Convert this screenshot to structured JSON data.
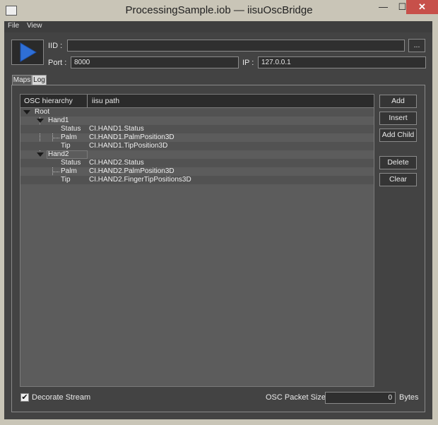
{
  "window": {
    "title": "ProcessingSample.iob — iisuOscBridge",
    "minimize_glyph": "—",
    "maximize_glyph": "☐",
    "close_glyph": "✕"
  },
  "menu": {
    "file": "File",
    "view": "View"
  },
  "header": {
    "iid_label": "IID :",
    "iid_value": "",
    "browse_label": "...",
    "port_label": "Port :",
    "port_value": "8000",
    "ip_label": "IP :",
    "ip_value": "127.0.0.1"
  },
  "tabs": {
    "maps": "Maps",
    "log": "Log"
  },
  "tree": {
    "col_osc": "OSC hierarchy",
    "col_path": "iisu path",
    "rows": [
      {
        "label": "Root",
        "path": ""
      },
      {
        "label": "Hand1",
        "path": ""
      },
      {
        "label": "Status",
        "path": "CI.HAND1.Status"
      },
      {
        "label": "Palm",
        "path": "CI.HAND1.PalmPosition3D"
      },
      {
        "label": "Tip",
        "path": "CI.HAND1.TipPosition3D"
      },
      {
        "label": "Hand2",
        "path": ""
      },
      {
        "label": "Status",
        "path": "CI.HAND2.Status"
      },
      {
        "label": "Palm",
        "path": "CI.HAND2.PalmPosition3D"
      },
      {
        "label": "Tip",
        "path": "CI.HAND2.FingerTipPositions3D"
      }
    ]
  },
  "buttons": {
    "add": "Add",
    "insert": "Insert",
    "add_child": "Add Child",
    "delete": "Delete",
    "clear": "Clear"
  },
  "footer": {
    "decorate_stream": "Decorate Stream",
    "decorate_checked_glyph": "✔",
    "packet_size_label": "OSC Packet Size :",
    "packet_size_value": "0",
    "bytes_label": "Bytes"
  },
  "colors": {
    "play_blue": "#2f6fd6",
    "close_red": "#c7504a"
  }
}
